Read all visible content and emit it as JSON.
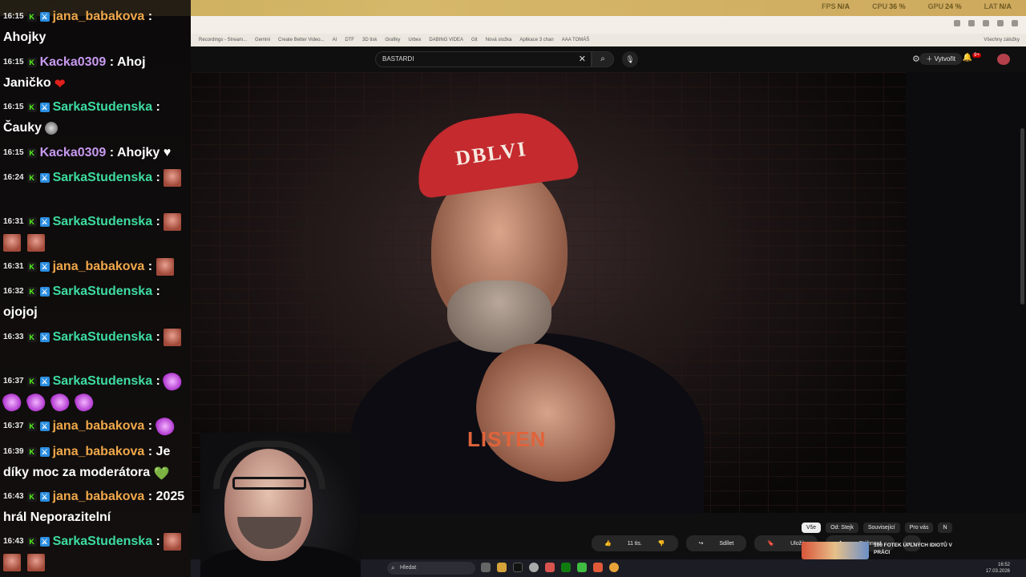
{
  "top_stats": {
    "fps_label": "FPS",
    "fps_value": "N/A",
    "cpu_label": "CPU",
    "cpu_value": "36 %",
    "gpu_label": "GPU",
    "gpu_value": "24 %",
    "lat_label": "LAT",
    "lat_value": "N/A"
  },
  "bookmarks": [
    "Recordings - Stream...",
    "Gemini",
    "Create Better Video...",
    "AI",
    "DTF",
    "3D tisk",
    "Grafiky",
    "Urbex",
    "DABING VIDEA",
    "Git",
    "Nová složka",
    "Aplikace 3 chan",
    "AAA TOMÁŠ",
    "Všechny záložky"
  ],
  "youtube": {
    "search_value": "BASTARDI",
    "create_label": "Vytvořit",
    "notif_count": "9+",
    "actions": {
      "likes": "11 tis.",
      "share": "Sdílet",
      "save": "Uložit",
      "download": "Stáhnout"
    },
    "chips": [
      "Vše",
      "Od: Stejk",
      "Související",
      "Pro vás",
      "N"
    ],
    "suggest_title": "100 FOTEK ÚPLNÝCH IDIOTŮ V PRÁCI"
  },
  "video": {
    "shirt_text": "LISTEN",
    "cap_text": "DBLVI"
  },
  "taskbar": {
    "search_placeholder": "Hledat",
    "time": "16:52",
    "date": "17.03.2026"
  },
  "chat": [
    {
      "time": "16:15",
      "user": "jana_babakova",
      "color": "orange",
      "mod": true,
      "text": "Ahojky",
      "emotes": []
    },
    {
      "time": "16:15",
      "user": "Kacka0309",
      "color": "purple",
      "mod": false,
      "text": "Ahoj Janičko",
      "emotes": [
        "heart"
      ]
    },
    {
      "time": "16:15",
      "user": "SarkaStudenska",
      "color": "green",
      "mod": true,
      "text": "Čauky",
      "emotes": [
        "ghost"
      ]
    },
    {
      "time": "16:15",
      "user": "Kacka0309",
      "color": "purple",
      "mod": false,
      "text": "Ahojky ♥",
      "emotes": []
    },
    {
      "time": "16:24",
      "user": "SarkaStudenska",
      "color": "green",
      "mod": true,
      "text": "",
      "emotes": [
        "face"
      ]
    },
    {
      "time": "16:31",
      "user": "SarkaStudenska",
      "color": "green",
      "mod": true,
      "text": "",
      "emotes": [
        "face",
        "face",
        "face"
      ]
    },
    {
      "time": "16:31",
      "user": "jana_babakova",
      "color": "orange",
      "mod": true,
      "text": "",
      "emotes": [
        "face"
      ]
    },
    {
      "time": "16:32",
      "user": "SarkaStudenska",
      "color": "green",
      "mod": true,
      "text": "ojojoj",
      "emotes": []
    },
    {
      "time": "16:33",
      "user": "SarkaStudenska",
      "color": "green",
      "mod": true,
      "text": "",
      "emotes": [
        "face"
      ]
    },
    {
      "time": "16:37",
      "user": "SarkaStudenska",
      "color": "green",
      "mod": true,
      "text": "",
      "emotes": [
        "puff",
        "puff",
        "puff",
        "puff",
        "puff"
      ]
    },
    {
      "time": "16:37",
      "user": "jana_babakova",
      "color": "orange",
      "mod": true,
      "text": "",
      "emotes": [
        "puff"
      ]
    },
    {
      "time": "16:39",
      "user": "jana_babakova",
      "color": "orange",
      "mod": true,
      "text": "Je díky moc za moderátora",
      "emotes": [
        "heart2"
      ]
    },
    {
      "time": "16:43",
      "user": "jana_babakova",
      "color": "orange",
      "mod": true,
      "text": "2025 hrál Neporazitelní",
      "emotes": []
    },
    {
      "time": "16:43",
      "user": "SarkaStudenska",
      "color": "green",
      "mod": true,
      "text": "",
      "emotes": [
        "face",
        "face",
        "face"
      ]
    }
  ],
  "icons": {
    "kick_badge": "kick-icon",
    "mod_badge": "moderator-sword-icon"
  }
}
